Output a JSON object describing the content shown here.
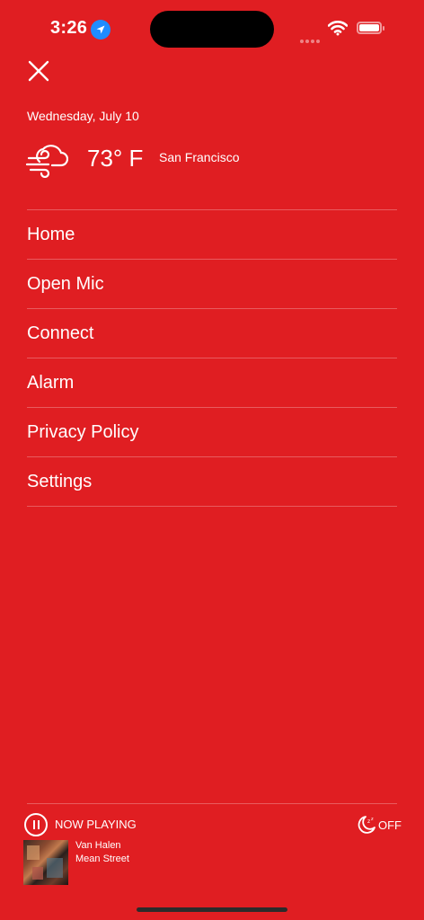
{
  "status_bar": {
    "time": "3:26"
  },
  "header": {
    "close_icon": "close-icon",
    "date": "Wednesday, July 10"
  },
  "weather": {
    "icon": "windy-cloud-icon",
    "temperature": "73° F",
    "city": "San Francisco"
  },
  "menu": {
    "items": [
      {
        "label": "Home"
      },
      {
        "label": "Open Mic"
      },
      {
        "label": "Connect"
      },
      {
        "label": "Alarm"
      },
      {
        "label": "Privacy Policy"
      },
      {
        "label": "Settings"
      }
    ]
  },
  "player": {
    "status": "NOW PLAYING",
    "sleep_timer_label": "OFF",
    "artist": "Van Halen",
    "track": "Mean Street"
  },
  "colors": {
    "background": "#e01e22",
    "foreground": "#ffffff",
    "location_icon": "#1f8cff"
  }
}
